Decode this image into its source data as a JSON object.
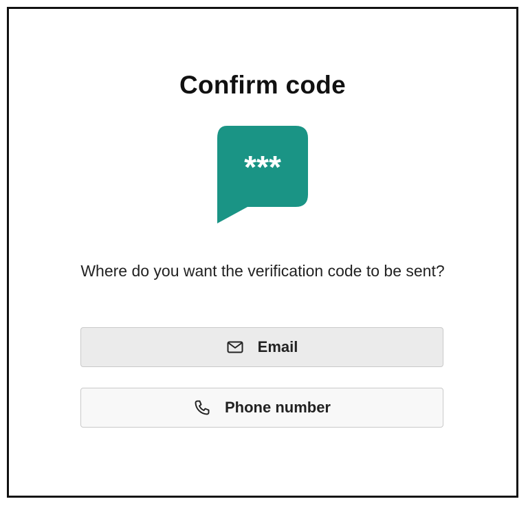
{
  "dialog": {
    "title": "Confirm code",
    "illustration": {
      "icon": "chat-bubble-password-icon",
      "text": "***",
      "color": "#1a9485"
    },
    "prompt": "Where do you want the verification code to be sent?",
    "options": [
      {
        "label": "Email",
        "icon": "envelope-icon"
      },
      {
        "label": "Phone number",
        "icon": "phone-icon"
      }
    ]
  }
}
